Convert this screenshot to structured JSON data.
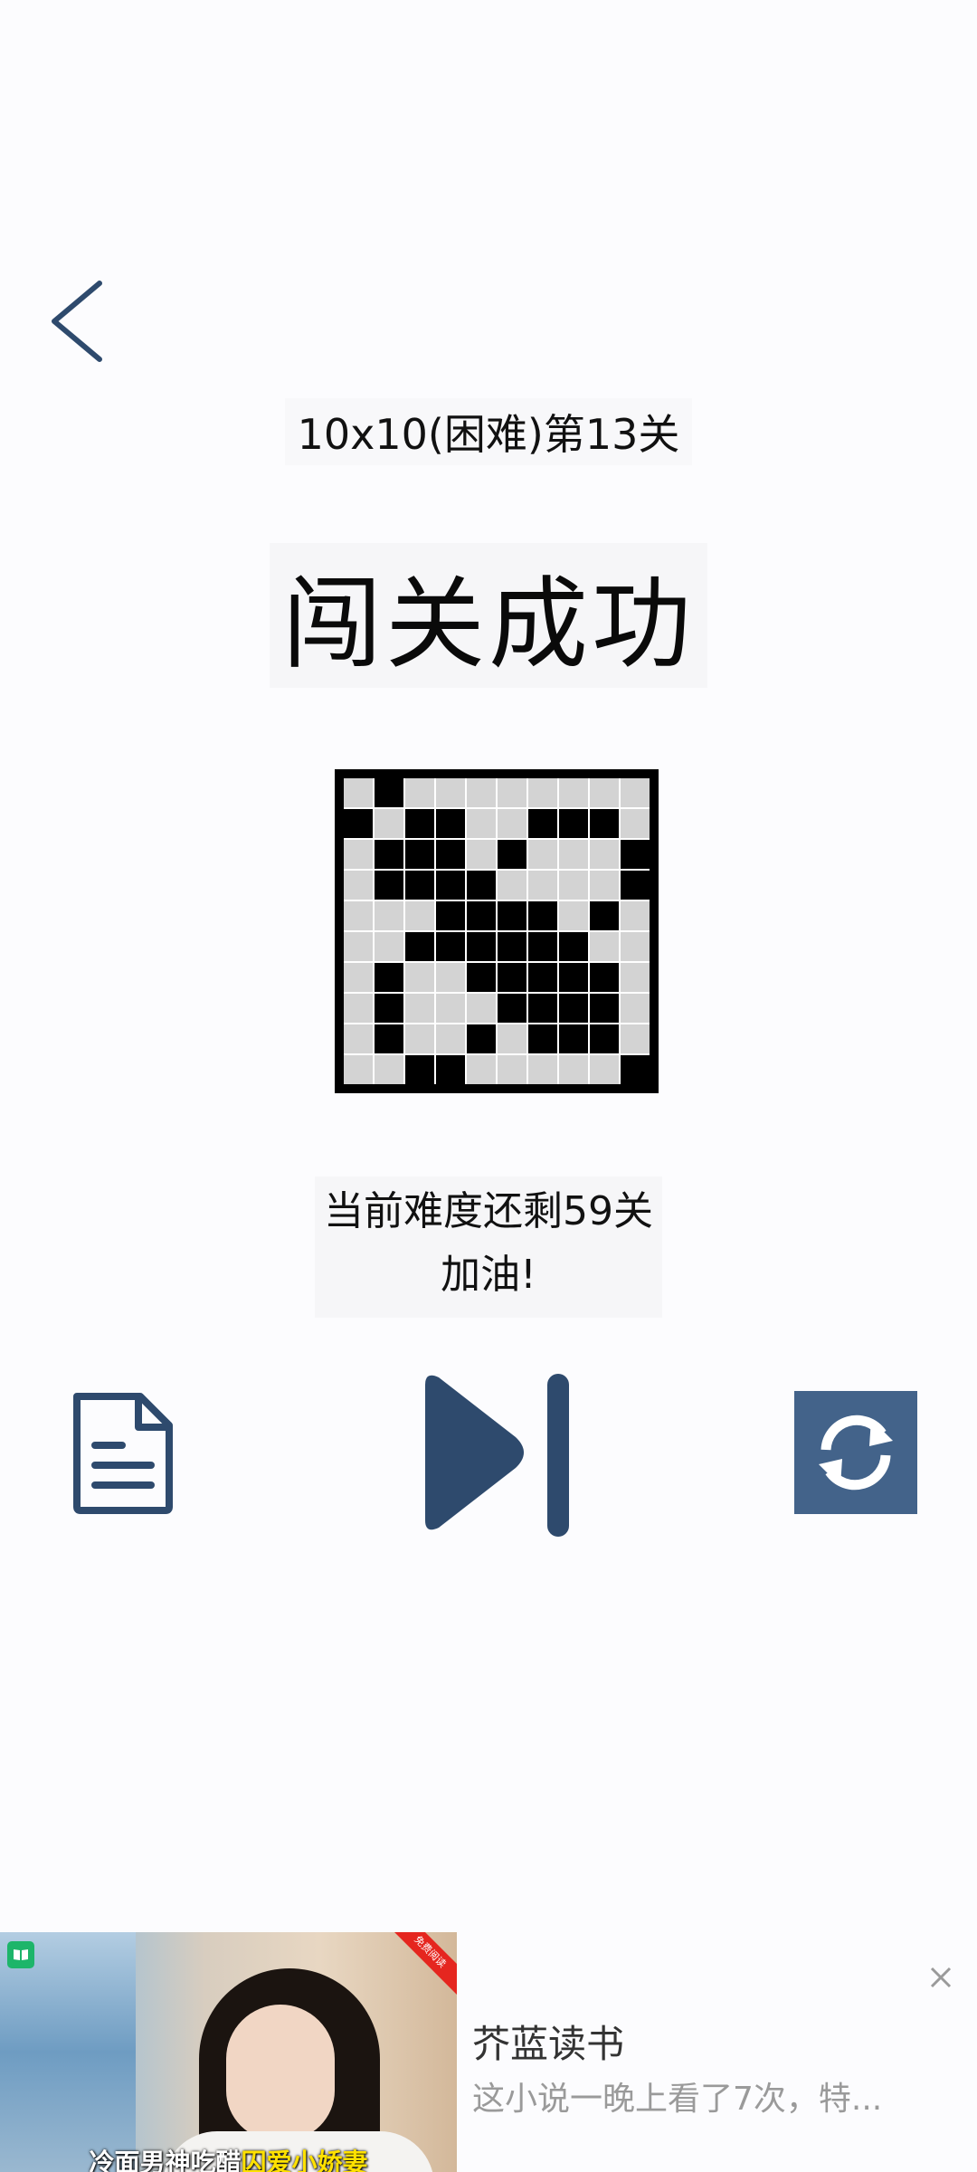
{
  "header": {
    "level_title": "10x10(困难)第13关",
    "success_title": "闯关成功"
  },
  "puzzle": {
    "rows": 10,
    "cols": 10,
    "grid": [
      [
        0,
        1,
        0,
        0,
        0,
        0,
        0,
        0,
        0,
        0
      ],
      [
        1,
        0,
        1,
        1,
        0,
        0,
        1,
        1,
        1,
        0
      ],
      [
        0,
        1,
        1,
        1,
        0,
        1,
        0,
        0,
        0,
        1
      ],
      [
        0,
        1,
        1,
        1,
        1,
        0,
        0,
        0,
        0,
        1
      ],
      [
        0,
        0,
        0,
        1,
        1,
        1,
        1,
        0,
        1,
        0
      ],
      [
        0,
        0,
        1,
        1,
        1,
        1,
        1,
        1,
        0,
        0
      ],
      [
        0,
        1,
        0,
        0,
        1,
        1,
        1,
        1,
        1,
        0
      ],
      [
        0,
        1,
        0,
        0,
        0,
        1,
        1,
        1,
        1,
        0
      ],
      [
        0,
        1,
        0,
        0,
        1,
        0,
        1,
        1,
        1,
        0
      ],
      [
        0,
        0,
        1,
        1,
        0,
        0,
        0,
        0,
        0,
        1
      ]
    ]
  },
  "status": {
    "remaining": "当前难度还剩59关",
    "cheer": "加油!"
  },
  "colors": {
    "accent": "#43638a",
    "icon_dark": "#2e4a6d"
  },
  "icons": {
    "back": "chevron-left-icon",
    "doc": "document-icon",
    "next": "skip-next-icon",
    "refresh": "refresh-icon",
    "close": "close-icon"
  },
  "ad": {
    "caption_part1": "冷面男神吃醋",
    "caption_part2": "囚爱小娇妻",
    "ribbon": "免费阅读",
    "brand": "芥蓝读书",
    "description": "这小说一晚上看了7次，特..."
  }
}
